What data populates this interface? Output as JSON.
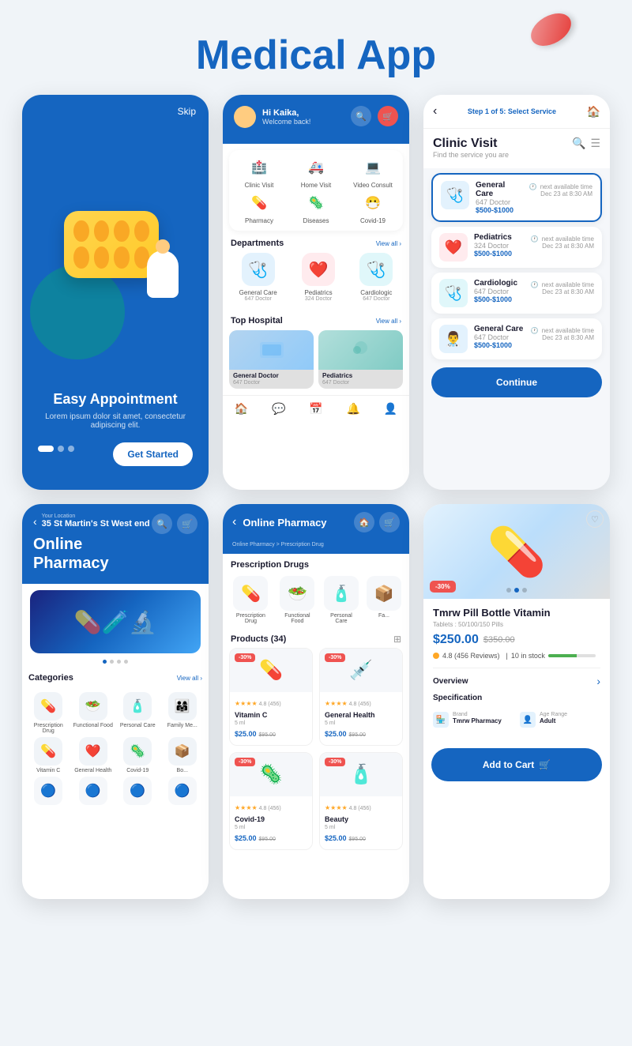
{
  "header": {
    "title_black": "Medical",
    "title_blue": "App"
  },
  "screen1": {
    "skip": "Skip",
    "title": "Easy Appointment",
    "description": "Lorem ipsum dolor sit amet, consectetur adipiscing elit.",
    "get_started": "Get Started",
    "dots": [
      true,
      false,
      false
    ]
  },
  "screen2": {
    "greeting": "Hi Kaika,",
    "welcome": "Welcome back!",
    "services": [
      {
        "icon": "🏥",
        "label": "Clinic Visit"
      },
      {
        "icon": "🚑",
        "label": "Home Visit"
      },
      {
        "icon": "💻",
        "label": "Video Consult"
      },
      {
        "icon": "💊",
        "label": "Pharmacy"
      },
      {
        "icon": "🦠",
        "label": "Diseases"
      },
      {
        "icon": "😷",
        "label": "Covid-19"
      }
    ],
    "departments_title": "Departments",
    "view_all": "View all",
    "departments": [
      {
        "icon": "🩺",
        "label": "General Care",
        "count": "647 Doctor",
        "color": "blue"
      },
      {
        "icon": "❤️",
        "label": "Pediatrics",
        "count": "324 Doctor",
        "color": "red"
      },
      {
        "icon": "🩺",
        "label": "Cardiologic",
        "count": "647 Doctor",
        "color": "teal"
      }
    ],
    "top_hospital": "Top Hospital",
    "hospitals": [
      {
        "label": "General Doctor",
        "count": "647 Doctor"
      },
      {
        "label": "Pediatrics",
        "count": "647 Doctor"
      }
    ]
  },
  "screen3": {
    "step": "Step 1 of 5: Select Service",
    "title": "Clinic Visit",
    "subtitle": "Find the service you are",
    "services": [
      {
        "name": "General Care",
        "count": "647 Doctor",
        "price": "$500-$1000",
        "date": "Dec 23 at 8:30 AM",
        "color": "blue",
        "icon": "🩺"
      },
      {
        "name": "Pediatrics",
        "count": "324 Doctor",
        "price": "$500-$1000",
        "date": "Dec 23 at 8:30 AM",
        "color": "red",
        "icon": "❤️"
      },
      {
        "name": "Cardiologic",
        "count": "647 Doctor",
        "price": "$500-$1000",
        "date": "Dec 23 at 8:30 AM",
        "color": "teal",
        "icon": "🩺"
      },
      {
        "name": "General Care",
        "count": "647 Doctor",
        "price": "$500-$1000",
        "date": "Dec 23 at 8:30 AM",
        "color": "blue",
        "icon": "👨‍⚕️"
      }
    ],
    "next_available": "next available time",
    "continue": "Continue"
  },
  "screen4": {
    "your_location": "Your Location",
    "location": "35 St Martin's St West end",
    "title_line1": "Online",
    "title_line2": "Pharmacy",
    "categories_title": "Categories",
    "view_all": "View all",
    "categories": [
      {
        "icon": "💊",
        "label": "Prescription Drug"
      },
      {
        "icon": "🥗",
        "label": "Functional Food"
      },
      {
        "icon": "🧴",
        "label": "Personal Care"
      },
      {
        "icon": "👨‍👩‍👧",
        "label": "Family Me..."
      }
    ],
    "categories2": [
      {
        "icon": "💊",
        "label": "Vitamin C"
      },
      {
        "icon": "❤️",
        "label": "General Health"
      },
      {
        "icon": "🦠",
        "label": "Covid-19"
      },
      {
        "icon": "📦",
        "label": "Bo..."
      }
    ]
  },
  "screen5": {
    "title": "Online Pharmacy",
    "breadcrumb": "Online Pharmacy > Prescription Drug",
    "prescription_title": "Prescription Drugs",
    "presc_items": [
      {
        "icon": "💊",
        "label": "Prescription Drug"
      },
      {
        "icon": "🥗",
        "label": "Functional Food"
      },
      {
        "icon": "🧴",
        "label": "Personal Care"
      },
      {
        "icon": "📦",
        "label": "Fa..."
      }
    ],
    "products_title": "Products (34)",
    "products": [
      {
        "badge": "-30%",
        "name": "Vitamin C",
        "volume": "5 ml",
        "rating": "4.8",
        "reviews": "(456)",
        "price": "$25.00",
        "original": "$95.00",
        "icon": "💊"
      },
      {
        "badge": "-30%",
        "name": "General Health",
        "volume": "5 ml",
        "rating": "4.8",
        "reviews": "(456)",
        "price": "$25.00",
        "original": "$95.00",
        "icon": "💉"
      },
      {
        "badge": "-30%",
        "name": "Covid-19",
        "volume": "5 ml",
        "rating": "4.8",
        "reviews": "(456)",
        "price": "$25.00",
        "original": "$95.00",
        "icon": "🦠"
      },
      {
        "badge": "-30%",
        "name": "Beauty",
        "volume": "5 ml",
        "rating": "4.8",
        "reviews": "(456)",
        "price": "$25.00",
        "original": "$95.00",
        "icon": "🧴"
      }
    ]
  },
  "screen6": {
    "product_name": "Tmrw Pill Bottle Vitamin",
    "product_sub": "Tablets : 50/100/150 Pills",
    "price": "$250.00",
    "original_price": "$350.00",
    "discount": "-30%",
    "rating": "4.8 (456 Reviews)",
    "stock": "10 in stock",
    "overview_title": "Overview",
    "spec_title": "Specification",
    "brand_label": "Brand",
    "brand_value": "Tmrw Pharmacy",
    "age_label": "Age Range",
    "age_value": "Adult",
    "add_to_cart": "Add to Cart"
  }
}
